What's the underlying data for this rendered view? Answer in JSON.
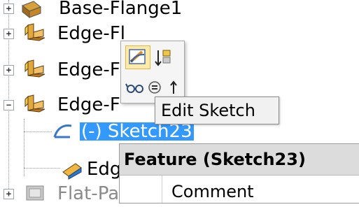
{
  "tree": {
    "rows": [
      {
        "label": "Base-Flange1"
      },
      {
        "label": "Edge-Fl"
      },
      {
        "label": "Edge-F"
      },
      {
        "label": "Edge-F"
      },
      {
        "label": "(-) Sketch23"
      },
      {
        "label": "Edg"
      },
      {
        "label": "Flat-Pa"
      }
    ]
  },
  "context_menu": {
    "tooltip": "Edit Sketch",
    "icons": [
      "edit-sketch-icon",
      "sort-icon",
      "glasses-icon",
      "equation-icon",
      "arrow-up-icon"
    ]
  },
  "property_panel": {
    "title": "Feature (Sketch23)",
    "row_label": "Comment"
  },
  "colors": {
    "selection": "#3399ff",
    "panel_header": "#dcdcdc",
    "highlight": "#fde9a8"
  }
}
